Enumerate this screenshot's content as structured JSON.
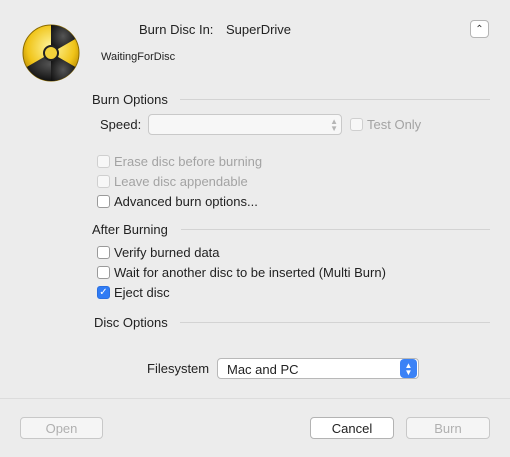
{
  "header": {
    "burn_disc_in_label": "Burn Disc In:",
    "device": "SuperDrive",
    "status": "WaitingForDisc",
    "collapse_icon": "chevron-up-icon"
  },
  "burn_options": {
    "title": "Burn Options",
    "speed_label": "Speed:",
    "speed_value": "",
    "test_only_label": "Test Only",
    "erase_label": "Erase disc before burning",
    "appendable_label": "Leave disc appendable",
    "advanced_label": "Advanced burn options..."
  },
  "after_burning": {
    "title": "After Burning",
    "verify_label": "Verify burned data",
    "wait_label": "Wait for another disc to be inserted (Multi Burn)",
    "eject_label": "Eject disc",
    "eject_checked": true
  },
  "disc_options": {
    "title": "Disc Options",
    "filesystem_label": "Filesystem",
    "filesystem_value": "Mac and PC"
  },
  "footer": {
    "open_label": "Open",
    "cancel_label": "Cancel",
    "burn_label": "Burn"
  },
  "colors": {
    "accent": "#2f7bf5",
    "background": "#ececec"
  }
}
